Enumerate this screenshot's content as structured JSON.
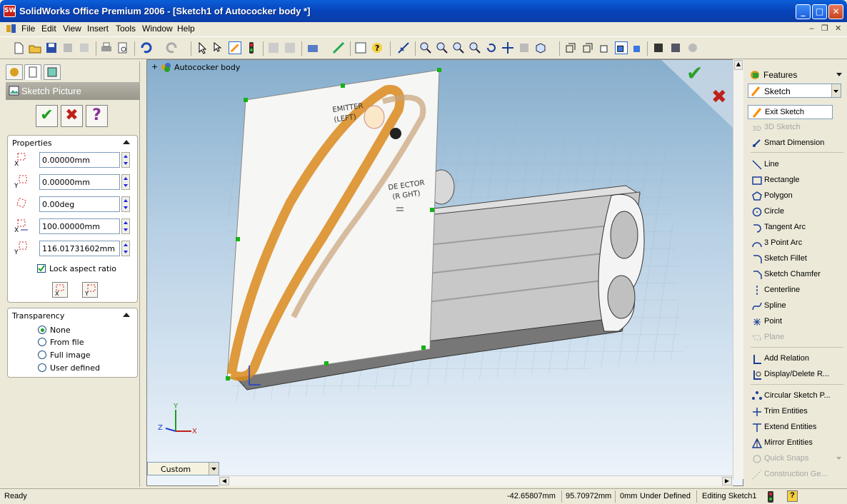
{
  "window": {
    "title": "SolidWorks Office Premium 2006 - [Sketch1 of Autococker body *]",
    "app_icon_text": "SW",
    "minimize_glyph": "_",
    "maximize_glyph": "□",
    "close_glyph": "✕"
  },
  "menu": [
    "File",
    "Edit",
    "View",
    "Insert",
    "Tools",
    "Window",
    "Help"
  ],
  "doc_controls": {
    "minimize": "‒",
    "restore": "❐",
    "close": "✕"
  },
  "property_manager": {
    "title": "Sketch Picture",
    "ok_glyph": "✔",
    "cancel_glyph": "✖",
    "help_glyph": "?",
    "properties": {
      "title": "Properties",
      "x_value": "0.00000mm",
      "y_value": "0.00000mm",
      "angle_value": "0.00deg",
      "width_value": "100.00000mm",
      "height_value": "116.01731602mm",
      "lock_aspect_label": "Lock aspect ratio",
      "lock_aspect_checked": true
    },
    "transparency": {
      "title": "Transparency",
      "options": [
        "None",
        "From file",
        "Full image",
        "User defined"
      ],
      "selected": "None"
    }
  },
  "viewport": {
    "tree_root": "Autococker body",
    "sketch_labels": [
      "EMITTER",
      "(LEFT)",
      "DE ECTOR",
      "(R GHT)"
    ],
    "axis_labels": {
      "x": "X",
      "y": "Y",
      "z": "Z"
    },
    "view_orientation": "Custom",
    "confirm_ok_glyph": "✔",
    "confirm_cancel_glyph": "✖"
  },
  "command_manager": {
    "tab_features": "Features",
    "tab_sketch": "Sketch",
    "items": [
      {
        "label": "Exit Sketch",
        "enabled": true,
        "active": true
      },
      {
        "label": "3D Sketch",
        "enabled": false
      },
      {
        "label": "Smart Dimension",
        "enabled": true
      },
      {
        "label": "Line",
        "enabled": true
      },
      {
        "label": "Rectangle",
        "enabled": true
      },
      {
        "label": "Polygon",
        "enabled": true
      },
      {
        "label": "Circle",
        "enabled": true
      },
      {
        "label": "Tangent Arc",
        "enabled": true
      },
      {
        "label": "3 Point Arc",
        "enabled": true
      },
      {
        "label": "Sketch Fillet",
        "enabled": true
      },
      {
        "label": "Sketch Chamfer",
        "enabled": true
      },
      {
        "label": "Centerline",
        "enabled": true
      },
      {
        "label": "Spline",
        "enabled": true
      },
      {
        "label": "Point",
        "enabled": true
      },
      {
        "label": "Plane",
        "enabled": false
      },
      {
        "label": "Add Relation",
        "enabled": true
      },
      {
        "label": "Display/Delete R...",
        "enabled": true
      },
      {
        "label": "Circular Sketch P...",
        "enabled": true
      },
      {
        "label": "Trim Entities",
        "enabled": true
      },
      {
        "label": "Extend Entities",
        "enabled": true
      },
      {
        "label": "Mirror Entities",
        "enabled": true
      },
      {
        "label": "Quick Snaps",
        "enabled": false
      },
      {
        "label": "Construction Ge...",
        "enabled": false
      }
    ]
  },
  "status_bar": {
    "status": "Ready",
    "x_coord": "-42.65807mm",
    "y_coord": "95.70972mm",
    "z_coord": "0mm",
    "definition": "Under Defined",
    "mode": "Editing Sketch1",
    "help_glyph": "?"
  },
  "colors": {
    "titlebar": "#0a5fd8",
    "accept_green": "#1e9e1e",
    "cancel_red": "#c0201a",
    "help_purple": "#8a2f9e",
    "sketch_point_green": "#16b216",
    "model_grey": "#c8c8c8"
  }
}
